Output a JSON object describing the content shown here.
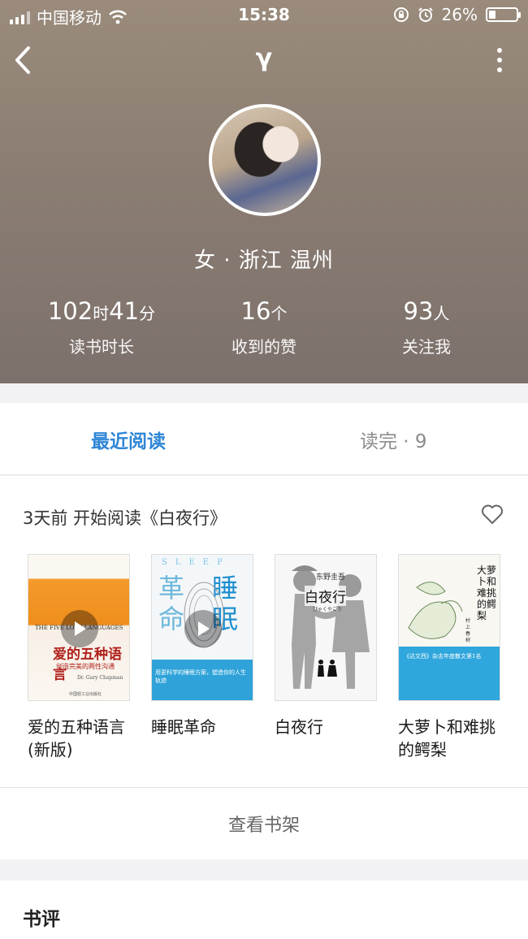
{
  "status_bar": {
    "carrier": "中国移动",
    "time": "15:38",
    "battery": "26%",
    "battery_level": 0.26
  },
  "nav": {
    "title": "γ"
  },
  "profile": {
    "gender_location": "女 · 浙江 温州",
    "stats": [
      {
        "value_parts": [
          "102",
          "时",
          "41",
          "分"
        ],
        "label": "读书时长"
      },
      {
        "value_parts": [
          "16",
          "个"
        ],
        "label": "收到的赞"
      },
      {
        "value_parts": [
          "93",
          "人"
        ],
        "label": "关注我"
      }
    ]
  },
  "tabs": {
    "recent": "最近阅读",
    "finished": "读完 · 9"
  },
  "recent": {
    "heading": "3天前 开始阅读《白夜行》",
    "books": [
      {
        "title": "爱的五种语言(新版)",
        "cover_title": "爱的五种语言",
        "cover_en": "THE FIVE LOVE LANGUAGES",
        "cover_sub": "创造完美的两性沟通",
        "cover_author": "Dr. Gary Chapman",
        "cover_publisher": "中国轻工业出版社",
        "has_video": true
      },
      {
        "title": "睡眠革命",
        "cover_title_a": "革命",
        "cover_title_b": "睡眠",
        "cover_en": "SLEEP",
        "cover_tagline": "用更科学的睡眠方案，塑造你的人生轨迹",
        "has_video": true
      },
      {
        "title": "白夜行",
        "cover_author": "东野圭吾",
        "cover_title": "白夜行",
        "cover_kana": "びゃくやこう",
        "has_video": false
      },
      {
        "title": "大萝卜和难挑的鳄梨",
        "cover_title": "大萝卜和难挑的鳄梨",
        "cover_author": "村上春树",
        "cover_blurb": "《达文西》杂志年度散文第1名",
        "has_video": false
      }
    ]
  },
  "shelf": {
    "button": "查看书架"
  },
  "review": {
    "title": "书评"
  },
  "colors": {
    "accent": "#2f86d6",
    "header_bg": "#8b7d72"
  }
}
